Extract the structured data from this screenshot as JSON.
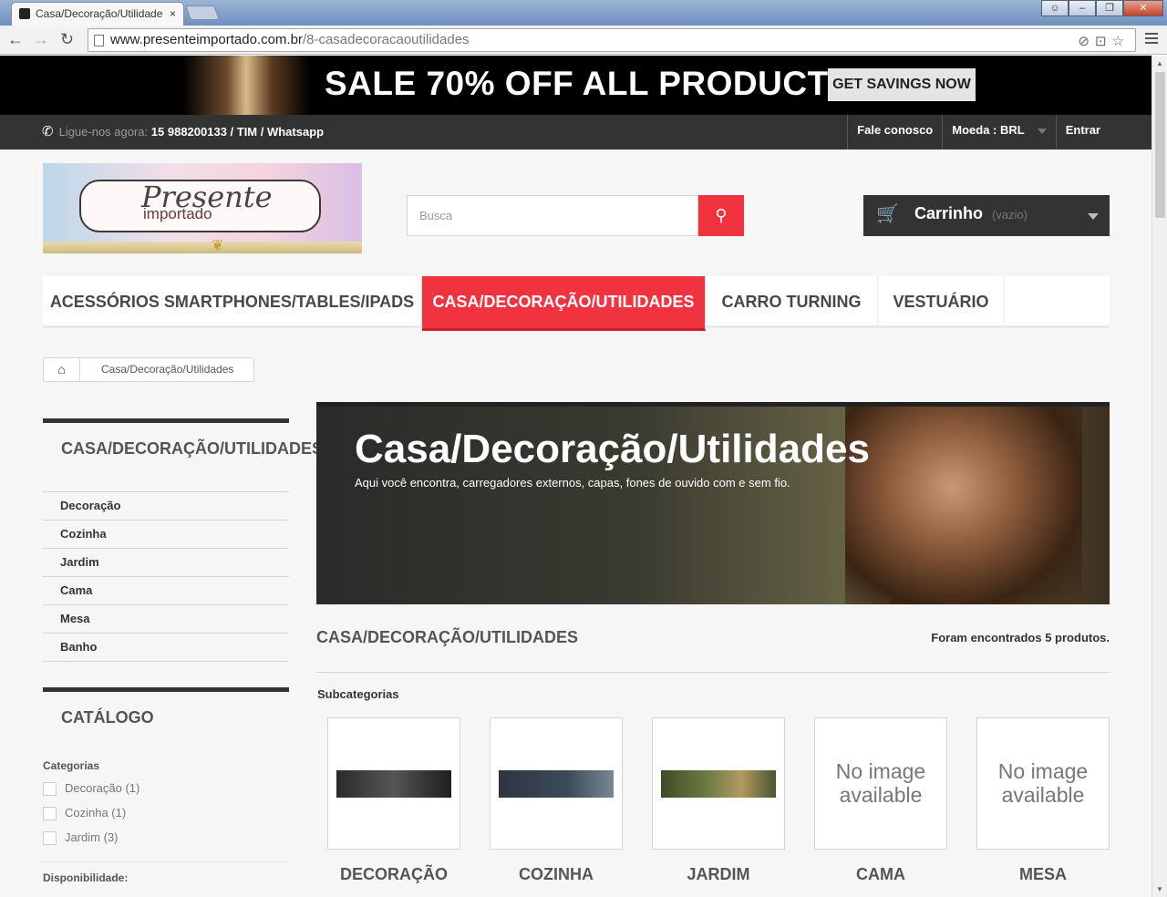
{
  "browser": {
    "tab_title": "Casa/Decoração/Utilidade",
    "tab_close": "×",
    "url_host": "www.presenteimportado.com.br",
    "url_path": "/8-casadecoracaoutilidades",
    "back_icon": "←",
    "forward_icon": "→",
    "reload_icon": "↻"
  },
  "banner": {
    "headline": "SALE 70% OFF ALL PRODUCTS",
    "cta": "GET SAVINGS NOW"
  },
  "topnav": {
    "phone_label": "Ligue-nos agora:",
    "phone_number": "15 988200133 / TIM / Whatsapp",
    "contact": "Fale conosco",
    "currency": "Moeda : BRL",
    "login": "Entrar"
  },
  "logo": {
    "line1": "Presente",
    "line2": "importado"
  },
  "search": {
    "placeholder": "Busca"
  },
  "cart": {
    "label": "Carrinho",
    "status": "(vazio)"
  },
  "menu": [
    "ACESSÓRIOS SMARTPHONES/TABLES/IPADS",
    "CASA/DECORAÇÃO/UTILIDADES",
    "CARRO TURNING",
    "VESTUÁRIO"
  ],
  "breadcrumb": {
    "current": "Casa/Decoração/Utilidades"
  },
  "sidebar": {
    "category_title": "CASA/DECORAÇÃO/UTILIDADES",
    "categories": [
      "Decoração",
      "Cozinha",
      "Jardim",
      "Cama",
      "Mesa",
      "Banho"
    ],
    "catalog_title": "CATÁLOGO",
    "filter_categories_label": "Categorias",
    "filter_options": [
      "Decoração (1)",
      "Cozinha (1)",
      "Jardim (3)"
    ],
    "availability_label": "Disponibilidade:"
  },
  "hero": {
    "title": "Casa/Decoração/Utilidades",
    "description": "Aqui você encontra, carregadores externos, capas, fones de ouvido com e sem fio."
  },
  "content": {
    "title": "CASA/DECORAÇÃO/UTILIDADES",
    "count": "Foram encontrados 5 produtos.",
    "subcategories_label": "Subcategorias",
    "no_image": "No image available",
    "subcategories": [
      "DECORAÇÃO",
      "COZINHA",
      "JARDIM",
      "CAMA",
      "MESA"
    ]
  },
  "colors": {
    "accent": "#f13340",
    "dark": "#333333"
  }
}
